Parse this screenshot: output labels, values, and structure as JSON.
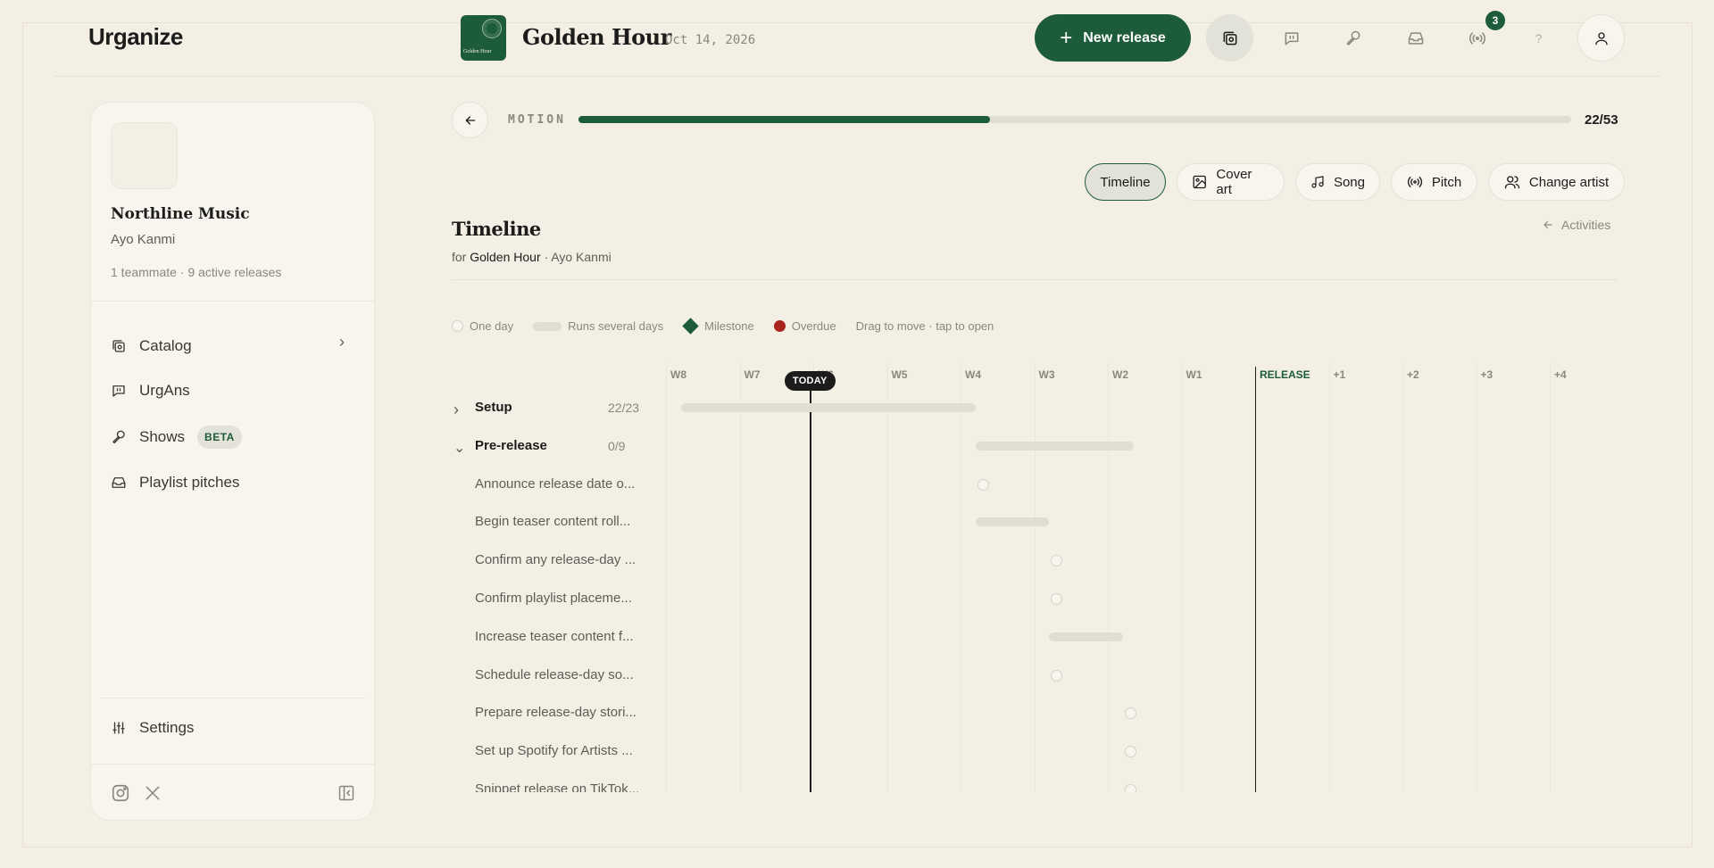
{
  "app": {
    "logo": "Urganize"
  },
  "header": {
    "release_title": "Golden Hour",
    "release_date": "Oct 14, 2026",
    "cover_caption": "Golden Hour",
    "new_release_label": "New release",
    "notifications_count": "3",
    "help_label": "?"
  },
  "sidebar": {
    "org_name": "Northline Music",
    "user_name": "Ayo Kanmi",
    "meta": "1 teammate · 9 active releases",
    "nav": [
      {
        "label": "Catalog"
      },
      {
        "label": "UrgAns"
      },
      {
        "label": "Shows",
        "badge": "BETA"
      },
      {
        "label": "Playlist pitches"
      }
    ],
    "settings_label": "Settings"
  },
  "progress": {
    "label": "MOTION",
    "done": 22,
    "total": 53,
    "fraction": 0.415,
    "count_text": "22/53"
  },
  "tabs": [
    {
      "label": "Timeline",
      "active": true
    },
    {
      "label": "Cover art"
    },
    {
      "label": "Song"
    },
    {
      "label": "Pitch"
    },
    {
      "label": "Change artist"
    }
  ],
  "timeline": {
    "title": "Timeline",
    "for_prefix": "for",
    "release_name": "Golden Hour",
    "artist_suffix": "· Ayo Kanmi",
    "activities_label": "Activities",
    "legend": {
      "one_day": "One day",
      "several_days": "Runs several days",
      "milestone": "Milestone",
      "overdue": "Overdue",
      "hint": "Drag to move · tap to open"
    },
    "today_label": "TODAY",
    "weeks": [
      "W8",
      "W7",
      "W6",
      "W5",
      "W4",
      "W3",
      "W2",
      "W1",
      "RELEASE",
      "+1",
      "+2",
      "+3",
      "+4"
    ],
    "groups": [
      {
        "label": "Setup",
        "count": "22/23",
        "expanded": false
      },
      {
        "label": "Pre-release",
        "count": "0/9",
        "expanded": true
      }
    ],
    "tasks": [
      "Announce release date o...",
      "Begin teaser content roll...",
      "Confirm any release-day ...",
      "Confirm playlist placeme...",
      "Increase teaser content f...",
      "Schedule release-day so...",
      "Prepare release-day stori...",
      "Set up Spotify for Artists ...",
      "Snippet release on TikTok..."
    ]
  },
  "colors": {
    "accent": "#1d5c3a",
    "background": "#f3efe5",
    "overdue": "#a8241c"
  },
  "icons": {
    "header": [
      "catalog-icon",
      "chat-icon",
      "microphone-icon",
      "inbox-icon",
      "broadcast-icon",
      "help-icon",
      "user-icon"
    ],
    "footer": [
      "instagram-icon",
      "x-icon",
      "collapse-sidebar-icon"
    ]
  }
}
